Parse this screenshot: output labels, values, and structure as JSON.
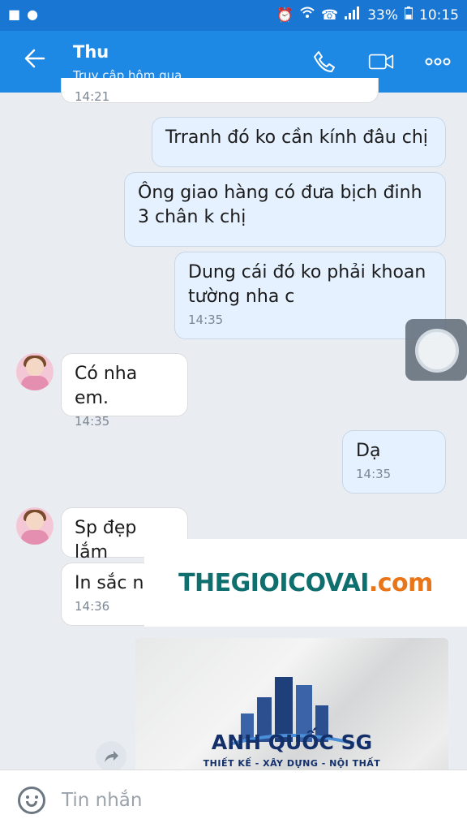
{
  "status_bar": {
    "battery": "33%",
    "time": "10:15"
  },
  "header": {
    "name": "Thu",
    "last_seen": "Truy cập hôm qua"
  },
  "messages": [
    {
      "dir": "in",
      "text": "",
      "time": "14:21"
    },
    {
      "dir": "out",
      "text": "Trranh đó ko cần kính đâu chị",
      "time": ""
    },
    {
      "dir": "out",
      "text": "Ông giao hàng có đưa bịch đinh 3 chân k chị",
      "time": ""
    },
    {
      "dir": "out",
      "text": "Dung cái đó ko phải khoan tường nha c",
      "time": "14:35"
    },
    {
      "dir": "in",
      "text": "Có nha em.",
      "time": "14:35"
    },
    {
      "dir": "out",
      "text": "Dạ",
      "time": "14:35"
    },
    {
      "dir": "in",
      "text": "Sp đẹp lắm",
      "time": ""
    },
    {
      "dir": "in",
      "text": "In sắc n",
      "time": "14:36"
    }
  ],
  "watermark": {
    "part1": "THEGIOICOVAI",
    "part2": ".com"
  },
  "photo": {
    "brand_name": "ANH QUỐC SG",
    "brand_tag": "THIẾT KẾ - XÂY DỰNG - NỘI THẤT"
  },
  "input": {
    "placeholder": "Tin nhắn"
  },
  "colors": {
    "status_bar": "#1976d2",
    "app_bar": "#1e88e5",
    "outgoing_bubble": "#e5f1ff",
    "incoming_bubble": "#ffffff",
    "watermark_teal": "#0f6e6e",
    "watermark_orange": "#e8751a"
  },
  "icons": {
    "back": "arrow-left-icon",
    "call": "phone-icon",
    "video": "video-camera-icon",
    "more": "more-dots-icon",
    "emoji": "emoji-icon",
    "share": "share-icon"
  }
}
